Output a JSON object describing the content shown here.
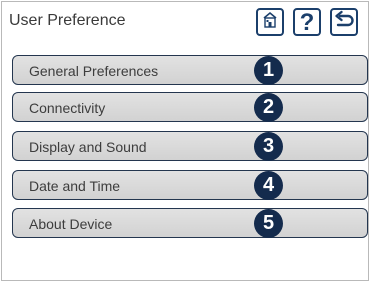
{
  "header": {
    "title": "User Preference",
    "buttons": [
      {
        "icon": "home-icon"
      },
      {
        "icon": "help-icon",
        "glyph": "?"
      },
      {
        "icon": "back-arrow-icon"
      }
    ]
  },
  "menu": {
    "items": [
      {
        "label": "General Preferences",
        "badge": "1"
      },
      {
        "label": "Connectivity",
        "badge": "2"
      },
      {
        "label": "Display and Sound",
        "badge": "3"
      },
      {
        "label": "Date and Time",
        "badge": "4"
      },
      {
        "label": "About Device",
        "badge": "5"
      }
    ]
  },
  "colors": {
    "accent": "#1b3f6b",
    "badge": "#142b4d",
    "button_fill": "#d9d9d9",
    "button_border": "#24364f"
  }
}
